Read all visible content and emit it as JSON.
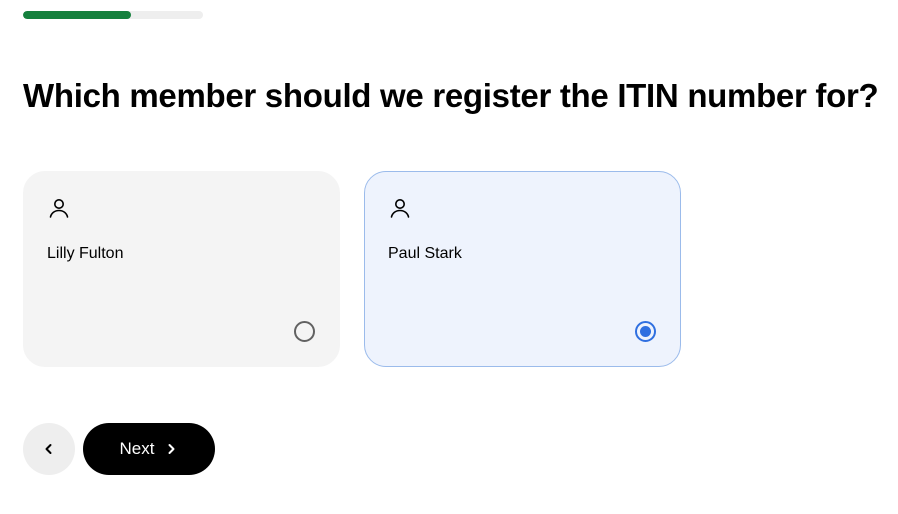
{
  "progress": {
    "fraction": 0.6,
    "fill_color": "#15803d",
    "track_color": "#eeeeee"
  },
  "title": "Which member should we register the ITIN number for?",
  "members": [
    {
      "name": "Lilly Fulton",
      "icon": "user-icon",
      "selected": false
    },
    {
      "name": "Paul Stark",
      "icon": "user-icon",
      "selected": true
    }
  ],
  "colors": {
    "selected_accent": "#2f6fe0",
    "selected_background": "#eef3fd",
    "card_background": "#f4f4f4"
  },
  "nav": {
    "back_icon": "chevron-left-icon",
    "next_label": "Next",
    "next_icon": "chevron-right-icon"
  }
}
